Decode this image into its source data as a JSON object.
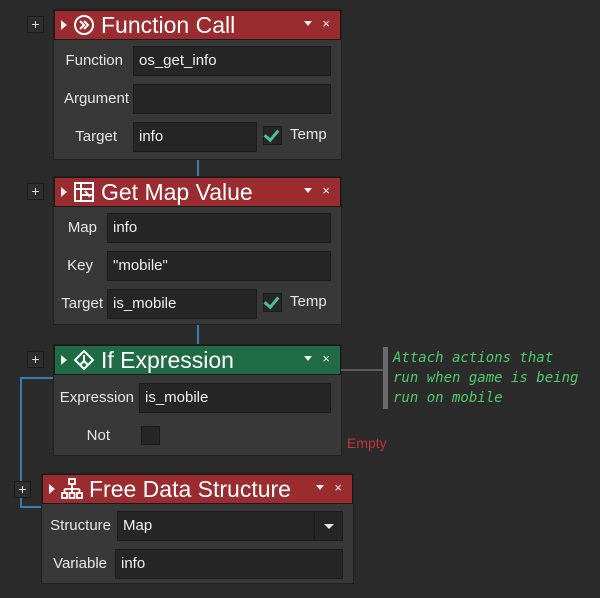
{
  "blocks": [
    {
      "title": "Function Call",
      "rows": [
        {
          "label": "Function",
          "value": "os_get_info"
        },
        {
          "label": "Argument",
          "value": ""
        },
        {
          "label": "Target",
          "value": "info",
          "temp_label": "Temp",
          "temp_checked": true
        }
      ]
    },
    {
      "title": "Get Map Value",
      "rows": [
        {
          "label": "Map",
          "value": "info"
        },
        {
          "label": "Key",
          "value": "\"mobile\""
        },
        {
          "label": "Target",
          "value": "is_mobile",
          "temp_label": "Temp",
          "temp_checked": true
        }
      ]
    },
    {
      "title": "If Expression",
      "rows": [
        {
          "label": "Expression",
          "value": "is_mobile"
        },
        {
          "label": "Not",
          "checked": false
        }
      ]
    },
    {
      "title": "Free Data Structure",
      "rows": [
        {
          "label": "Structure",
          "value": "Map"
        },
        {
          "label": "Variable",
          "value": "info"
        }
      ]
    }
  ],
  "comment": {
    "lines": [
      "Attach actions that",
      "run when game is being",
      "run on mobile"
    ]
  },
  "empty_label": "Empty",
  "controls": {
    "expand": "+",
    "close": "×"
  },
  "colors": {
    "action_header": "#9a2c30",
    "condition_header": "#1f6b45",
    "comment_text": "#4ecb6a",
    "empty_text": "#c2353b",
    "wire": "#3a7bb0"
  },
  "icons": {
    "function_call": "run-script-icon",
    "get_map_value": "map-grid-icon",
    "if_expression": "branch-diamond-icon",
    "free_data_structure": "hierarchy-icon"
  }
}
